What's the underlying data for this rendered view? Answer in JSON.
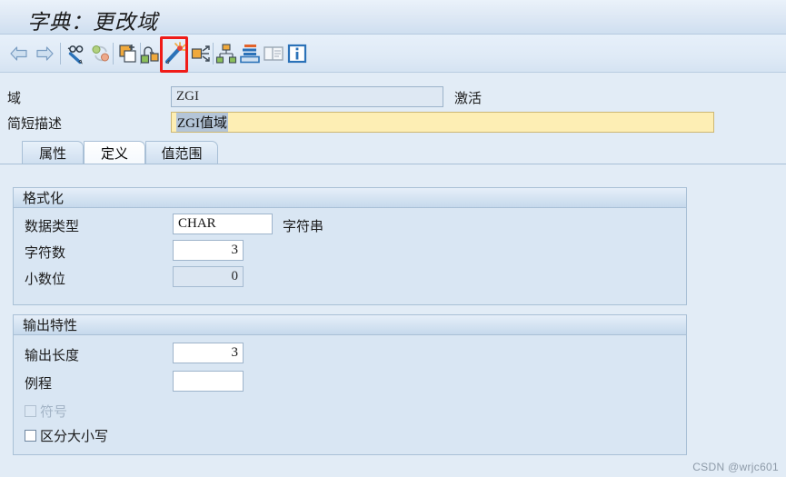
{
  "window": {
    "title": "字典：更改域"
  },
  "toolbar": {
    "items": [
      {
        "name": "back-icon",
        "label": "后退"
      },
      {
        "name": "forward-icon",
        "label": "前进"
      },
      {
        "name": "display-change-icon",
        "label": "显示 <-> 更改"
      },
      {
        "name": "refresh-icon",
        "label": "刷新"
      },
      {
        "name": "copy-object-icon",
        "label": "复制对象"
      },
      {
        "name": "where-used-icon",
        "label": "使用列表"
      },
      {
        "name": "magic-wand-icon",
        "label": "激活"
      },
      {
        "name": "expand-object-icon",
        "label": "展开"
      },
      {
        "name": "hierarchy-icon",
        "label": "层次"
      },
      {
        "name": "stack-icon",
        "label": "数据库对象"
      },
      {
        "name": "documentation-icon",
        "label": "文档"
      },
      {
        "name": "info-icon",
        "label": "信息"
      }
    ]
  },
  "header": {
    "domain_label": "域",
    "domain_value": "ZGI",
    "status_label": "激活",
    "description_label": "简短描述",
    "description_value": "ZGI值域"
  },
  "tabs": [
    {
      "label": "属性",
      "active": false
    },
    {
      "label": "定义",
      "active": true
    },
    {
      "label": "值范围",
      "active": false
    }
  ],
  "format_panel": {
    "title": "格式化",
    "data_type_label": "数据类型",
    "data_type_value": "CHAR",
    "data_type_hint": "字符串",
    "length_label": "字符数",
    "length_value": "3",
    "decimals_label": "小数位",
    "decimals_value": "0"
  },
  "output_panel": {
    "title": "输出特性",
    "output_length_label": "输出长度",
    "output_length_value": "3",
    "routine_label": "例程",
    "routine_value": "",
    "sign_label": "符号",
    "case_sensitive_label": "区分大小写"
  },
  "watermark": {
    "text": "CSDN @wrjc601"
  },
  "colors": {
    "background": "#e2ecf6",
    "panel": "#d9e6f3",
    "highlight_red": "#f01c18",
    "input_yellow": "#fdeeb4",
    "selection": "#b4c5d8"
  }
}
